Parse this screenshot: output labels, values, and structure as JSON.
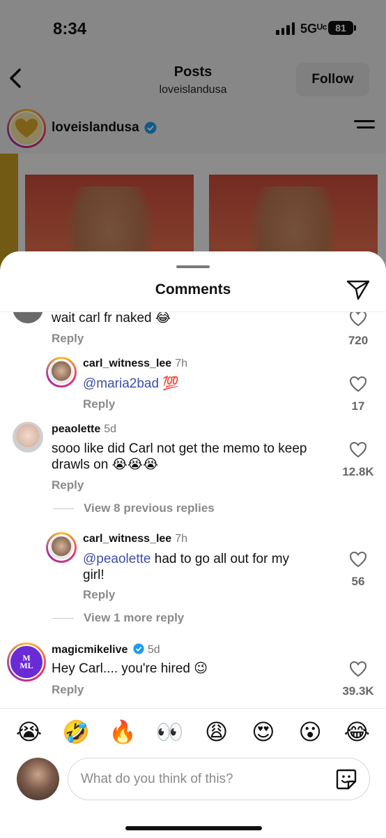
{
  "status": {
    "time": "8:34",
    "network": "5Gᵁᶜ",
    "battery": "81"
  },
  "header": {
    "title": "Posts",
    "subtitle": "loveislandusa",
    "follow_label": "Follow"
  },
  "profile": {
    "username": "loveislandusa",
    "verified": true
  },
  "sheet": {
    "title": "Comments"
  },
  "comments": [
    {
      "text": "wait carl fr naked 😂",
      "reply_label": "Reply",
      "likes": "720"
    },
    {
      "username": "carl_witness_lee",
      "time": "7h",
      "mention": "@maria2bad",
      "text": " 💯",
      "reply_label": "Reply",
      "likes": "17"
    },
    {
      "username": "peaolette",
      "time": "5d",
      "text": "sooo like did Carl not get the memo to keep drawls on 😭😭😭",
      "reply_label": "Reply",
      "likes": "12.8K"
    },
    {
      "username": "carl_witness_lee",
      "time": "7h",
      "mention": "@peaolette",
      "text": " had to go all out for my girl!",
      "reply_label": "Reply",
      "likes": "56"
    },
    {
      "username": "magicmikelive",
      "verified": true,
      "time": "5d",
      "text": "Hey Carl.... you're hired 😉",
      "reply_label": "Reply",
      "likes": "39.3K"
    }
  ],
  "view_replies": [
    "View 8 previous replies",
    "View 1 more reply"
  ],
  "quick_emojis": [
    "😭",
    "🤣",
    "🔥",
    "👀",
    "😩",
    "😍",
    "😮",
    "😂"
  ],
  "input": {
    "placeholder": "What do you think of this?"
  },
  "colors": {
    "accent": "#3d4fa8",
    "verified": "#1d9bf0",
    "muted": "#8a8a8a"
  }
}
